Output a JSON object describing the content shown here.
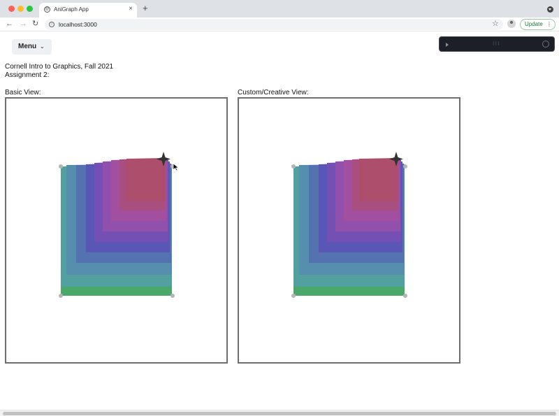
{
  "browser": {
    "tab_title": "AniGraph App",
    "tab_close": "×",
    "new_tab": "+",
    "favicon_glyph": "@",
    "nav_back": "←",
    "nav_forward": "→",
    "nav_reload": "↻",
    "url": "localhost:3000",
    "info_glyph": "i",
    "bookmark_glyph": "☆",
    "update_label": "Update",
    "update_menu_glyph": "⋮"
  },
  "app": {
    "menu_label": "Menu",
    "menu_chevron": "⌄",
    "gui_drag_glyph": "⁝⁝⁝",
    "title_line1": "Cornell Intro to Graphics, Fall 2021",
    "title_line2": "Assignment 2:",
    "views": [
      {
        "label": "Basic View:"
      },
      {
        "label": "Custom/Creative View:"
      }
    ]
  },
  "colors": {
    "frame_border": "#6e6e6e",
    "vertex_handle": "#b5b5b5",
    "star_handle": "#333333",
    "square_gradient": [
      "#4aa96a",
      "#5a9aa8",
      "#5472b0",
      "#5a56b6",
      "#8a4fb0",
      "#a14d9c",
      "#ad4f6c"
    ]
  },
  "icons": [
    "info-icon",
    "star-icon",
    "profile-icon",
    "kebab-icon",
    "chevron-down-icon",
    "play-icon",
    "drag-handle-icon",
    "search-icon",
    "sparkle-handle-icon",
    "cursor-icon"
  ]
}
